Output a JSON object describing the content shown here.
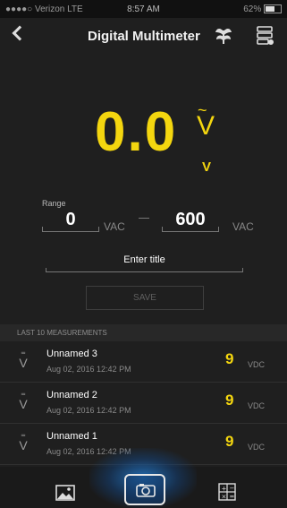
{
  "status": {
    "carrier": "●●●●○ Verizon  LTE",
    "time": "8:57 AM",
    "battery": "62%"
  },
  "nav": {
    "title": "Digital Multimeter",
    "back_icon": "chevron-left-icon",
    "leaf_icon": "leaf-icon",
    "list_icon": "list-icon"
  },
  "display": {
    "reading": "0.0",
    "ac_mark": "~",
    "unit_symbol": "V",
    "unit_label": "V",
    "accent_color": "#f4d60f"
  },
  "range": {
    "label": "Range",
    "min": "0",
    "min_unit": "VAC",
    "max": "600",
    "max_unit": "VAC"
  },
  "title_field": {
    "placeholder": "Enter title"
  },
  "save_button": {
    "label": "SAVE"
  },
  "measurements": {
    "header": "LAST 10 MEASUREMENTS",
    "items": [
      {
        "name": "Unnamed 3",
        "date": "Aug 02, 2016 12:42 PM",
        "value": "9",
        "unit": "VDC"
      },
      {
        "name": "Unnamed 2",
        "date": "Aug 02, 2016 12:42 PM",
        "value": "9",
        "unit": "VDC"
      },
      {
        "name": "Unnamed 1",
        "date": "Aug 02, 2016 12:42 PM",
        "value": "9",
        "unit": "VDC"
      }
    ]
  },
  "tabs": {
    "gallery": "image-gallery-icon",
    "camera": "camera-icon",
    "calculator": "calculator-icon"
  }
}
